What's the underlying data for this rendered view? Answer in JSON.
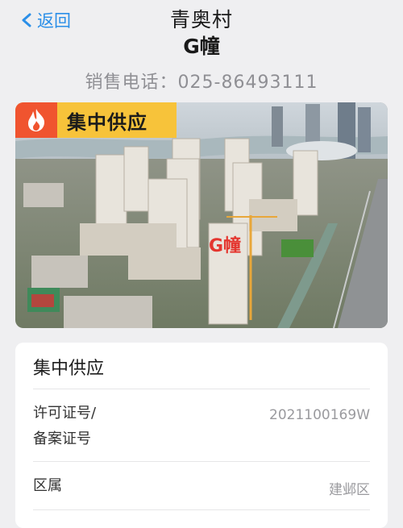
{
  "nav": {
    "back_label": "返回"
  },
  "header": {
    "title_line1": "青奥村",
    "title_line2": "G幢",
    "phone_label": "销售电话：",
    "phone_number": "025-86493111"
  },
  "hero": {
    "tag_label": "集中供应",
    "overlay_label": "G幢",
    "tag_color": "#f7c33a",
    "flame_color": "#f0542f",
    "icon": "fire-icon"
  },
  "card": {
    "title": "集中供应",
    "rows": [
      {
        "label_line1": "许可证号/",
        "label_line2": "备案证号",
        "value": "2021100169W"
      },
      {
        "label": "区属",
        "value": "建邺区"
      }
    ]
  },
  "colors": {
    "accent": "#2b8fe8",
    "background": "#efeff1"
  }
}
